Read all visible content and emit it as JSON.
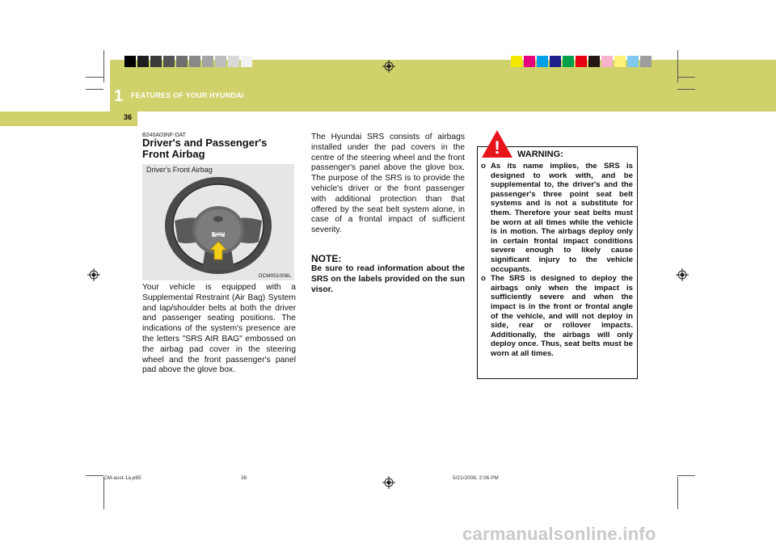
{
  "header": {
    "chapter_number": "1",
    "chapter_title": "FEATURES OF YOUR HYUNDAI",
    "page_number": "36"
  },
  "colors": {
    "band": "#cfd16a",
    "gray_swatches": [
      "#000000",
      "#1e1e1e",
      "#3a3a3a",
      "#555555",
      "#6f6f6f",
      "#888888",
      "#a3a3a3",
      "#bdbdbd",
      "#d8d8d8",
      "#f2f2f2"
    ],
    "color_swatches": [
      "#f2e800",
      "#e6007e",
      "#00a0e9",
      "#1d2088",
      "#00a04a",
      "#e60012",
      "#231815",
      "#f6b3c9",
      "#fff27a",
      "#7fc8ef",
      "#9d9d9d"
    ]
  },
  "section": {
    "code": "B240A03NF-DAT",
    "title": "Driver's and Passenger's Front Airbag"
  },
  "figure": {
    "label": "Driver's Front Airbag",
    "code": "OCM051008L",
    "hub_text": "SRS AIR BAG"
  },
  "col1_text": "Your vehicle is equipped with a Supplemental Restraint (Air Bag) System and lap/shoulder belts at both the driver and passenger seating positions. The indications of the system's presence are the letters \"SRS AIR BAG\" embossed on the airbag pad cover in the steering wheel and the front passenger's panel pad above the glove box.",
  "col2_text": "The Hyundai SRS consists of airbags installed under the pad covers in the centre of the steering wheel and the front passenger's panel above the glove box. The purpose of the SRS is to provide the vehicle's driver or the front passenger with additional protection than that offered by the seat belt system alone, in case of a frontal impact of sufficient severity.",
  "note": {
    "heading": "NOTE:",
    "text": "Be sure to read information about the SRS on the labels provided on the sun visor."
  },
  "warning": {
    "icon": "!",
    "title": "WARNING:",
    "items": [
      {
        "bullet": "o",
        "text": "As its name implies, the SRS is designed to work with, and be supplemental to, the driver's and the passenger's three point seat belt systems and is not a substitute for them. Therefore your seat belts must be worn at all times while the vehicle is in motion. The airbags deploy only in certain frontal impact conditions severe enough to likely cause significant injury to the vehicle occupants."
      },
      {
        "bullet": "o",
        "text": "The SRS is designed to deploy the airbags only when the impact is sufficiently severe and when the impact is in the front or frontal angle of the vehicle, and will not deploy in side, rear or rollover impacts. Additionally, the airbags will only deploy once. Thus, seat belts must be worn at all times."
      }
    ]
  },
  "footer": {
    "file": "CM-aust-1a.p65",
    "page": "36",
    "date": "5/21/2008, 2:06 PM"
  },
  "watermark": "carmanualsonline.info"
}
